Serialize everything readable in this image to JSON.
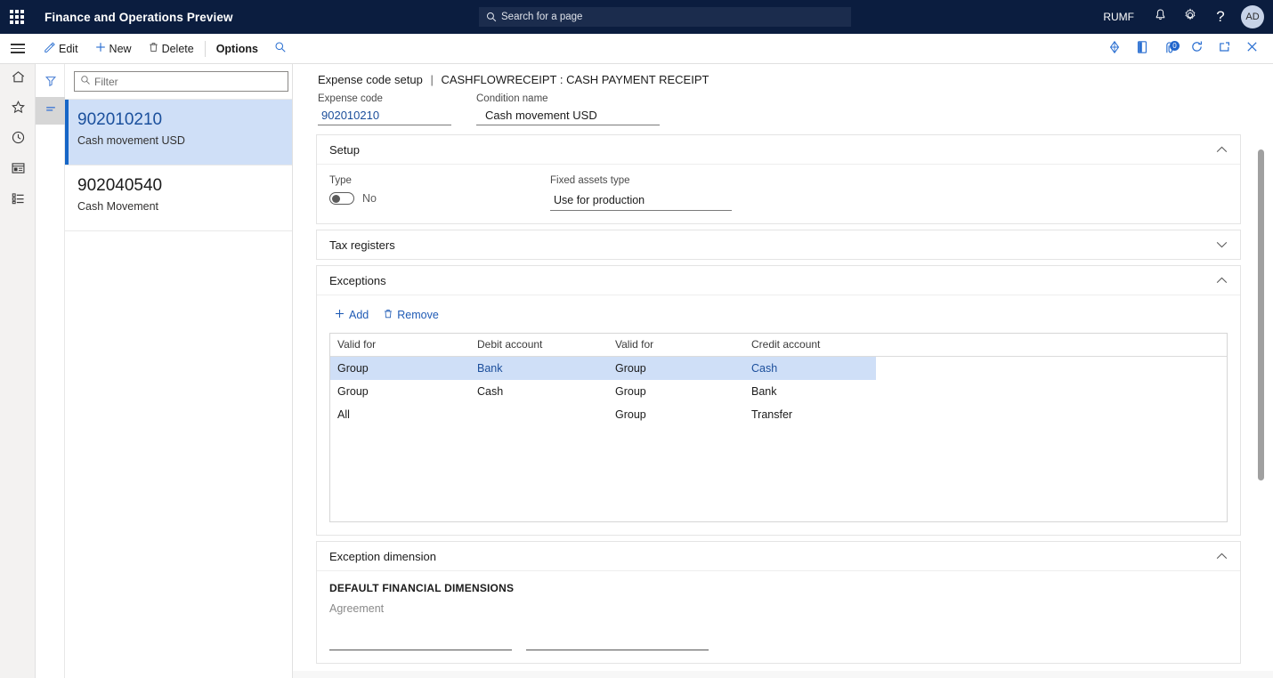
{
  "topbar": {
    "waffle_icon": "app-launcher-icon",
    "app_title": "Finance and Operations Preview",
    "search": {
      "icon": "search-icon",
      "placeholder": "Search for a page"
    },
    "company": "RUMF",
    "notifications_icon": "bell-icon",
    "settings_icon": "gear-icon",
    "help_icon": "question-mark-icon",
    "avatar_initials": "AD"
  },
  "actionpane": {
    "menu_icon": "hamburger-menu-icon",
    "buttons": [
      {
        "label": "Edit",
        "icon": "pencil-icon"
      },
      {
        "label": "New",
        "icon": "plus-icon"
      },
      {
        "label": "Delete",
        "icon": "trash-icon"
      },
      {
        "label": "Options",
        "icon": ""
      }
    ],
    "search_icon": "search-icon",
    "right_icons": [
      {
        "name": "office-integration-icon"
      },
      {
        "name": "open-in-office-icon"
      },
      {
        "name": "attachments-icon",
        "badge": "0"
      },
      {
        "name": "refresh-icon"
      },
      {
        "name": "popout-icon"
      },
      {
        "name": "close-icon"
      }
    ]
  },
  "leftrail": {
    "items": [
      {
        "name": "home-icon"
      },
      {
        "name": "favorites-star-icon"
      },
      {
        "name": "recent-clock-icon"
      },
      {
        "name": "workspaces-icon"
      },
      {
        "name": "modules-list-icon"
      }
    ]
  },
  "listpanel": {
    "tools": [
      {
        "name": "filter-funnel-icon",
        "active": false
      },
      {
        "name": "sort-list-icon",
        "active": true
      }
    ],
    "filter": {
      "icon": "search-icon",
      "placeholder": "Filter",
      "value": ""
    },
    "rows": [
      {
        "title": "902010210",
        "subtitle": "Cash movement USD",
        "selected": true
      },
      {
        "title": "902040540",
        "subtitle": "Cash Movement",
        "selected": false
      }
    ]
  },
  "main": {
    "breadcrumb": {
      "page": "Expense code setup",
      "separator": "|",
      "record": "CASHFLOWRECEIPT : CASH PAYMENT RECEIPT"
    },
    "header_fields": [
      {
        "label": "Expense code",
        "value": "902010210"
      },
      {
        "label": "Condition name",
        "value": "Cash movement USD"
      }
    ],
    "setup": {
      "title": "Setup",
      "expanded": true,
      "chevron": "chevron-up-icon",
      "type_label": "Type",
      "type_value": "No",
      "type_toggle_on": false,
      "fixed_assets_label": "Fixed assets type",
      "fixed_assets_value": "Use for production"
    },
    "tax_registers": {
      "title": "Tax registers",
      "expanded": false,
      "chevron": "chevron-down-icon"
    },
    "exceptions": {
      "title": "Exceptions",
      "expanded": true,
      "chevron": "chevron-up-icon",
      "add_label": "Add",
      "add_icon": "plus-icon",
      "remove_label": "Remove",
      "remove_icon": "trash-icon",
      "columns": [
        "Valid for",
        "Debit account",
        "Valid for",
        "Credit account"
      ],
      "rows": [
        {
          "cells": [
            "Group",
            "Bank",
            "Group",
            "Cash"
          ],
          "selected": true,
          "link_cols": [
            1,
            3
          ]
        },
        {
          "cells": [
            "Group",
            "Cash",
            "Group",
            "Bank"
          ],
          "selected": false,
          "link_cols": []
        },
        {
          "cells": [
            "All",
            "",
            "Group",
            "Transfer"
          ],
          "selected": false,
          "link_cols": []
        }
      ]
    },
    "exception_dimension": {
      "title": "Exception dimension",
      "expanded": true,
      "chevron": "chevron-up-icon",
      "section_heading": "DEFAULT FINANCIAL DIMENSIONS",
      "field_label": "Agreement",
      "dimension_inputs": [
        "",
        ""
      ]
    }
  },
  "colors": {
    "nav_background": "#0b1d3f",
    "accent_blue": "#1f5bb5",
    "selection_blue": "#cfdff7",
    "selection_bar": "#1666c7",
    "link_text": "#1b4e9b"
  }
}
